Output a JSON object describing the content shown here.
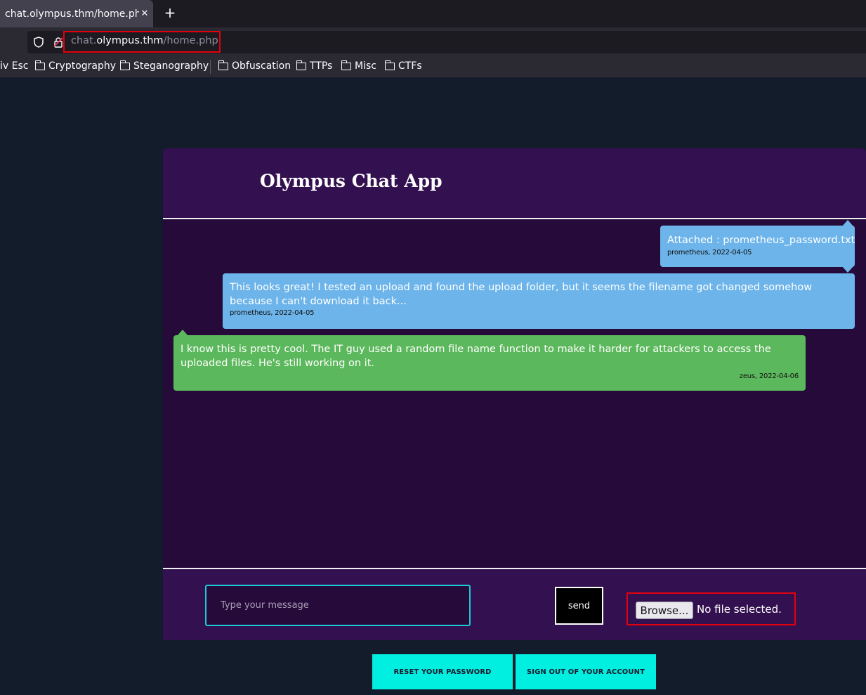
{
  "browser": {
    "tab_title": "chat.olympus.thm/home.php",
    "tab_close": "✕",
    "new_tab": "+",
    "url_prefix": "chat.",
    "url_host": "olympus.thm",
    "url_path": "/home.php",
    "bookmarks": [
      "iv Esc",
      "Cryptography",
      "Steganography",
      "Obfuscation",
      "TTPs",
      "Misc",
      "CTFs"
    ]
  },
  "app": {
    "title": "Olympus Chat App"
  },
  "messages": [
    {
      "text": "Attached : prometheus_password.txt",
      "meta": "prometheus, 2022-04-05"
    },
    {
      "text": "This looks great! I tested an upload and found the upload folder, but it seems the filename got changed somehow because I can't download it back...",
      "meta": "prometheus, 2022-04-05"
    },
    {
      "text": "I know this is pretty cool. The IT guy used a random file name function to make it harder for attackers to access the uploaded files. He's still working on it.",
      "meta": "zeus, 2022-04-06"
    }
  ],
  "composer": {
    "placeholder": "Type your message",
    "send_label": "send",
    "browse_label": "Browse...",
    "file_status": "No file selected."
  },
  "actions": {
    "reset_label": "RESET YOUR PASSWORD",
    "signout_label": "SIGN OUT OF YOUR ACCOUNT"
  },
  "colors": {
    "header_bg": "#33104f",
    "chat_bg": "#250a3a",
    "bubble_blue": "#6cb4ea",
    "bubble_green": "#5cb85c",
    "action_button": "#00efe0",
    "highlight": "#e3000d"
  }
}
